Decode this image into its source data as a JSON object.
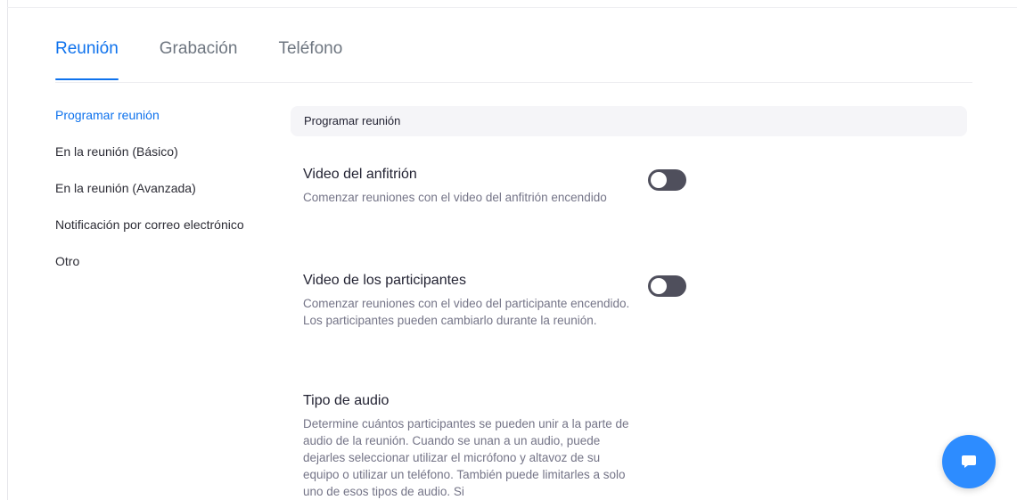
{
  "tabs": [
    {
      "label": "Reunión",
      "active": true
    },
    {
      "label": "Grabación",
      "active": false
    },
    {
      "label": "Teléfono",
      "active": false
    }
  ],
  "sidebar": {
    "items": [
      {
        "label": "Programar reunión",
        "active": true
      },
      {
        "label": "En la reunión (Básico)",
        "active": false
      },
      {
        "label": "En la reunión (Avanzada)",
        "active": false
      },
      {
        "label": "Notificación por correo electrónico",
        "active": false
      },
      {
        "label": "Otro",
        "active": false
      }
    ]
  },
  "section": {
    "title": "Programar reunión"
  },
  "settings": [
    {
      "title": "Video del anfitrión",
      "description": "Comenzar reuniones con el video del anfitrión encendido",
      "toggle": "off"
    },
    {
      "title": "Video de los participantes",
      "description": "Comenzar reuniones con el video del participante encendido. Los participantes pueden cambiarlo durante la reunión.",
      "toggle": "off"
    },
    {
      "title": "Tipo de audio",
      "description": "Determine cuántos participantes se pueden unir a la parte de audio de la reunión. Cuando se unan a un audio, puede dejarles seleccionar utilizar el micrófono y altavoz de su equipo o utilizar un teléfono. También puede limitarles a solo uno de esos tipos de audio. Si"
    }
  ],
  "colors": {
    "accent": "#0e72ed",
    "toggle_off": "#4f4f5c",
    "chat_button": "#2d8cff"
  },
  "icons": {
    "chat": "chat-bubble-icon"
  }
}
